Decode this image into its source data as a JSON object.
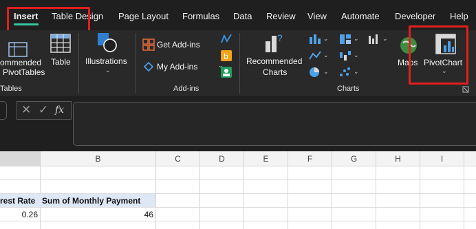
{
  "tabs": [
    {
      "label": "Insert",
      "active": true
    },
    {
      "label": "Table Design",
      "active": false
    },
    {
      "label": "Page Layout",
      "active": false
    },
    {
      "label": "Formulas",
      "active": false
    },
    {
      "label": "Data",
      "active": false
    },
    {
      "label": "Review",
      "active": false
    },
    {
      "label": "View",
      "active": false
    },
    {
      "label": "Automate",
      "active": false
    },
    {
      "label": "Developer",
      "active": false
    },
    {
      "label": "Help",
      "active": false
    }
  ],
  "ribbon": {
    "tables": {
      "recommended_label_1": "ommended",
      "recommended_label_2": "PivotTables",
      "table_label": "Table",
      "group_label": "Tables"
    },
    "illustrations": {
      "label": "Illustrations"
    },
    "addins": {
      "get_addins": "Get Add-ins",
      "my_addins": "My Add-ins",
      "group_label": "Add-ins"
    },
    "charts": {
      "recommended_label_1": "Recommended",
      "recommended_label_2": "Charts",
      "maps_label": "Maps",
      "pivotchart_label": "PivotChart",
      "group_label": "Charts"
    }
  },
  "formula_bar": {
    "fx": "fx",
    "value": ""
  },
  "grid": {
    "columns": [
      "B",
      "C",
      "D",
      "E",
      "F",
      "G",
      "H",
      "I"
    ],
    "header_row": {
      "a": "rest Rate",
      "b": "Sum of Monthly Payment"
    },
    "data_row": {
      "a": "0.26",
      "b": "46"
    }
  },
  "colors": {
    "accent_tab": "#36c7a0",
    "highlight": "#e21f1f",
    "pivot_header_fill": "#dde7f6"
  }
}
